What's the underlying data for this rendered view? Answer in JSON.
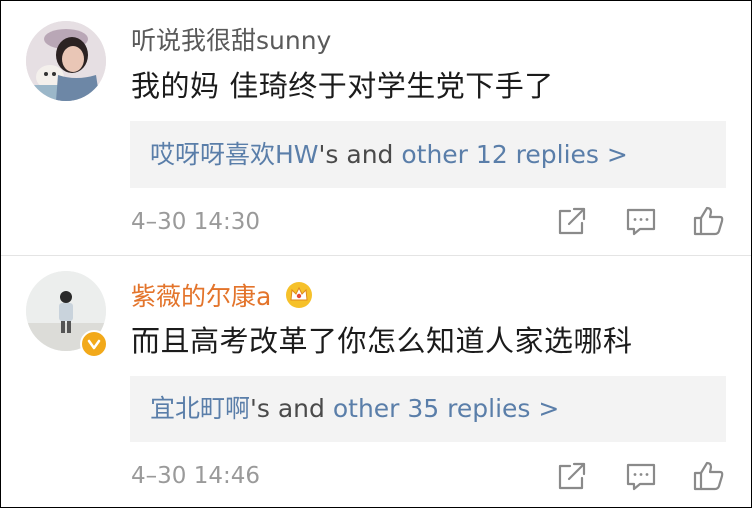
{
  "comments": [
    {
      "username": "听说我很甜sunny",
      "text": "我的妈  佳琦终于对学生党下手了",
      "replies": {
        "name": "哎呀呀喜欢HW",
        "mid": "'s and ",
        "more": "other 12 replies >"
      },
      "timestamp": "4–30 14:30",
      "colors": {
        "username": "#5a5a5a"
      }
    },
    {
      "username": "紫薇的尔康a",
      "text": "而且高考改革了你怎么知道人家选哪科",
      "replies": {
        "name": "宜北町啊",
        "mid": "'s and ",
        "more": "other 35 replies >"
      },
      "timestamp": "4–30 14:46",
      "colors": {
        "username": "#e3742b"
      }
    }
  ],
  "colors": {
    "link": "#5a7ea9",
    "reply_bg": "#f3f3f3",
    "muted": "#9a9a9a"
  }
}
